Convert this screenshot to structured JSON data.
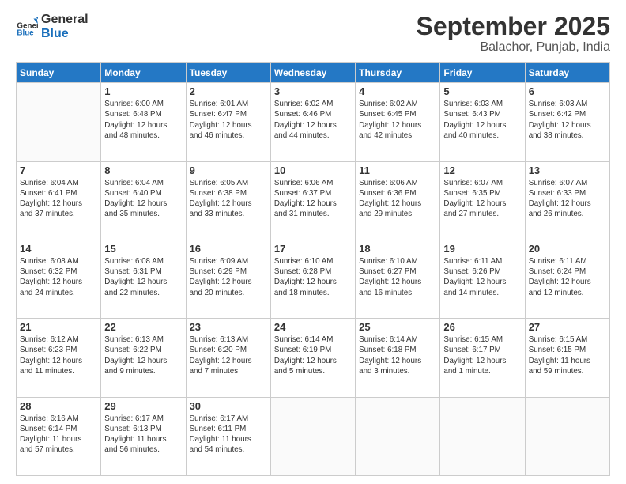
{
  "logo": {
    "general": "General",
    "blue": "Blue"
  },
  "header": {
    "month": "September 2025",
    "location": "Balachor, Punjab, India"
  },
  "weekdays": [
    "Sunday",
    "Monday",
    "Tuesday",
    "Wednesday",
    "Thursday",
    "Friday",
    "Saturday"
  ],
  "weeks": [
    [
      {
        "day": "",
        "info": ""
      },
      {
        "day": "1",
        "info": "Sunrise: 6:00 AM\nSunset: 6:48 PM\nDaylight: 12 hours\nand 48 minutes."
      },
      {
        "day": "2",
        "info": "Sunrise: 6:01 AM\nSunset: 6:47 PM\nDaylight: 12 hours\nand 46 minutes."
      },
      {
        "day": "3",
        "info": "Sunrise: 6:02 AM\nSunset: 6:46 PM\nDaylight: 12 hours\nand 44 minutes."
      },
      {
        "day": "4",
        "info": "Sunrise: 6:02 AM\nSunset: 6:45 PM\nDaylight: 12 hours\nand 42 minutes."
      },
      {
        "day": "5",
        "info": "Sunrise: 6:03 AM\nSunset: 6:43 PM\nDaylight: 12 hours\nand 40 minutes."
      },
      {
        "day": "6",
        "info": "Sunrise: 6:03 AM\nSunset: 6:42 PM\nDaylight: 12 hours\nand 38 minutes."
      }
    ],
    [
      {
        "day": "7",
        "info": "Sunrise: 6:04 AM\nSunset: 6:41 PM\nDaylight: 12 hours\nand 37 minutes."
      },
      {
        "day": "8",
        "info": "Sunrise: 6:04 AM\nSunset: 6:40 PM\nDaylight: 12 hours\nand 35 minutes."
      },
      {
        "day": "9",
        "info": "Sunrise: 6:05 AM\nSunset: 6:38 PM\nDaylight: 12 hours\nand 33 minutes."
      },
      {
        "day": "10",
        "info": "Sunrise: 6:06 AM\nSunset: 6:37 PM\nDaylight: 12 hours\nand 31 minutes."
      },
      {
        "day": "11",
        "info": "Sunrise: 6:06 AM\nSunset: 6:36 PM\nDaylight: 12 hours\nand 29 minutes."
      },
      {
        "day": "12",
        "info": "Sunrise: 6:07 AM\nSunset: 6:35 PM\nDaylight: 12 hours\nand 27 minutes."
      },
      {
        "day": "13",
        "info": "Sunrise: 6:07 AM\nSunset: 6:33 PM\nDaylight: 12 hours\nand 26 minutes."
      }
    ],
    [
      {
        "day": "14",
        "info": "Sunrise: 6:08 AM\nSunset: 6:32 PM\nDaylight: 12 hours\nand 24 minutes."
      },
      {
        "day": "15",
        "info": "Sunrise: 6:08 AM\nSunset: 6:31 PM\nDaylight: 12 hours\nand 22 minutes."
      },
      {
        "day": "16",
        "info": "Sunrise: 6:09 AM\nSunset: 6:29 PM\nDaylight: 12 hours\nand 20 minutes."
      },
      {
        "day": "17",
        "info": "Sunrise: 6:10 AM\nSunset: 6:28 PM\nDaylight: 12 hours\nand 18 minutes."
      },
      {
        "day": "18",
        "info": "Sunrise: 6:10 AM\nSunset: 6:27 PM\nDaylight: 12 hours\nand 16 minutes."
      },
      {
        "day": "19",
        "info": "Sunrise: 6:11 AM\nSunset: 6:26 PM\nDaylight: 12 hours\nand 14 minutes."
      },
      {
        "day": "20",
        "info": "Sunrise: 6:11 AM\nSunset: 6:24 PM\nDaylight: 12 hours\nand 12 minutes."
      }
    ],
    [
      {
        "day": "21",
        "info": "Sunrise: 6:12 AM\nSunset: 6:23 PM\nDaylight: 12 hours\nand 11 minutes."
      },
      {
        "day": "22",
        "info": "Sunrise: 6:13 AM\nSunset: 6:22 PM\nDaylight: 12 hours\nand 9 minutes."
      },
      {
        "day": "23",
        "info": "Sunrise: 6:13 AM\nSunset: 6:20 PM\nDaylight: 12 hours\nand 7 minutes."
      },
      {
        "day": "24",
        "info": "Sunrise: 6:14 AM\nSunset: 6:19 PM\nDaylight: 12 hours\nand 5 minutes."
      },
      {
        "day": "25",
        "info": "Sunrise: 6:14 AM\nSunset: 6:18 PM\nDaylight: 12 hours\nand 3 minutes."
      },
      {
        "day": "26",
        "info": "Sunrise: 6:15 AM\nSunset: 6:17 PM\nDaylight: 12 hours\nand 1 minute."
      },
      {
        "day": "27",
        "info": "Sunrise: 6:15 AM\nSunset: 6:15 PM\nDaylight: 11 hours\nand 59 minutes."
      }
    ],
    [
      {
        "day": "28",
        "info": "Sunrise: 6:16 AM\nSunset: 6:14 PM\nDaylight: 11 hours\nand 57 minutes."
      },
      {
        "day": "29",
        "info": "Sunrise: 6:17 AM\nSunset: 6:13 PM\nDaylight: 11 hours\nand 56 minutes."
      },
      {
        "day": "30",
        "info": "Sunrise: 6:17 AM\nSunset: 6:11 PM\nDaylight: 11 hours\nand 54 minutes."
      },
      {
        "day": "",
        "info": ""
      },
      {
        "day": "",
        "info": ""
      },
      {
        "day": "",
        "info": ""
      },
      {
        "day": "",
        "info": ""
      }
    ]
  ]
}
